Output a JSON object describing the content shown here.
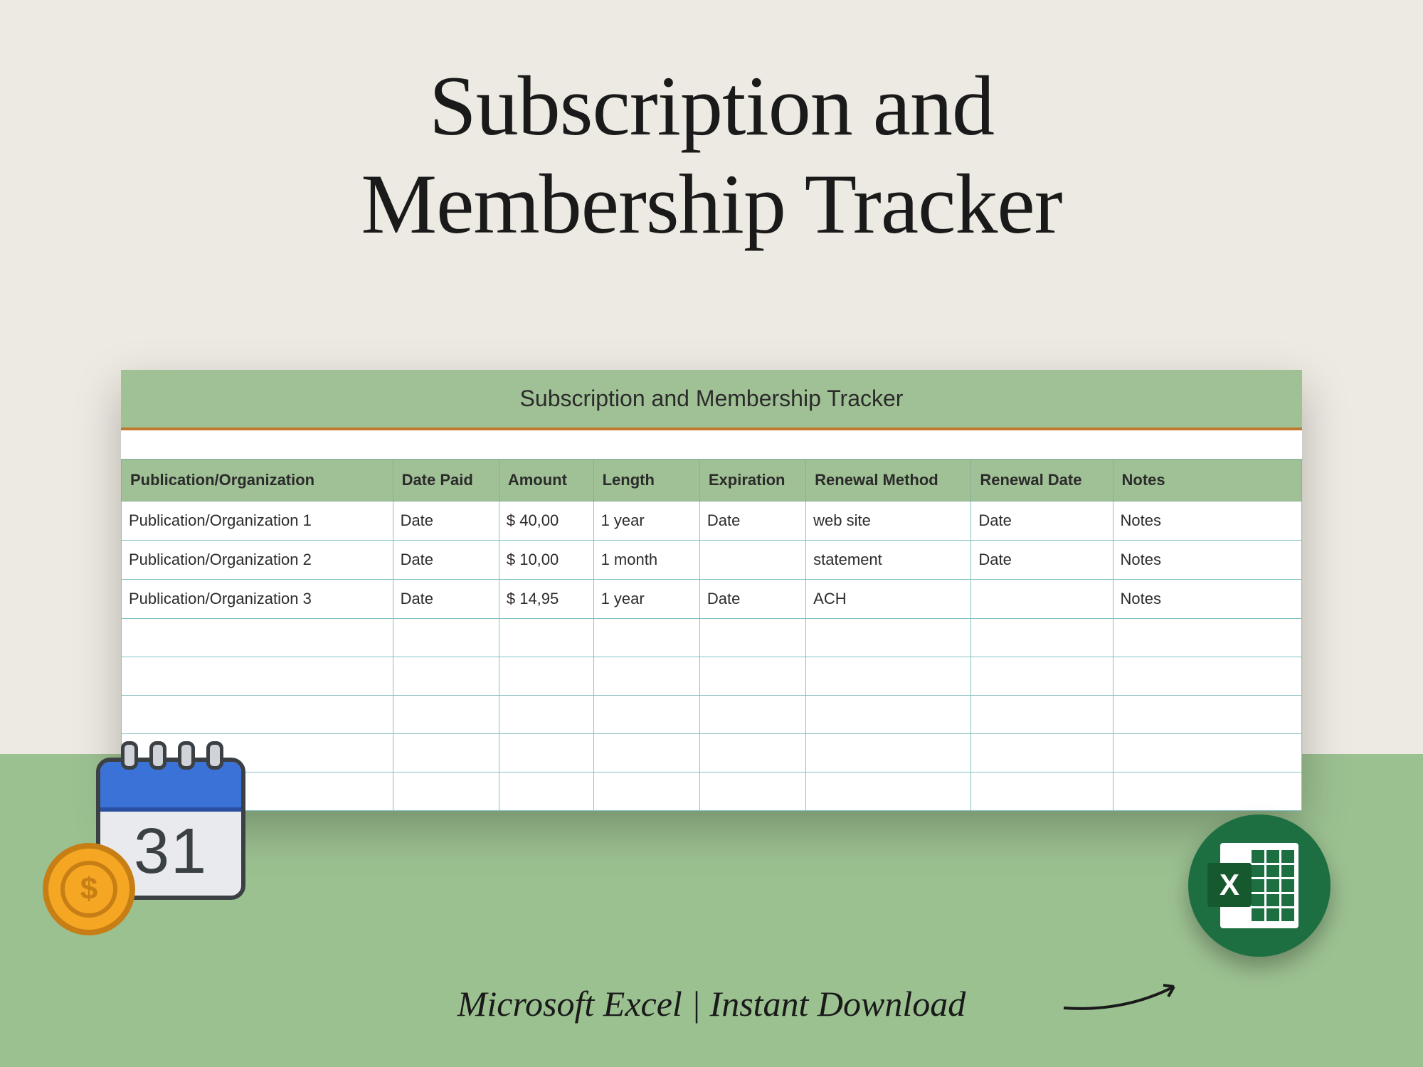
{
  "title_line1": "Subscription and",
  "title_line2": "Membership Tracker",
  "sheet_title": "Subscription and Membership Tracker",
  "columns": {
    "pub": "Publication/Organization",
    "date_paid": "Date Paid",
    "amount": "Amount",
    "length": "Length",
    "expiration": "Expiration",
    "renewal_method": "Renewal Method",
    "renewal_date": "Renewal Date",
    "notes": "Notes"
  },
  "rows": [
    {
      "pub": "Publication/Organization 1",
      "date_paid": "Date",
      "amount": "$   40,00",
      "length": "1 year",
      "expiration": "Date",
      "renewal_method": "web site",
      "renewal_date": "Date",
      "notes": "Notes"
    },
    {
      "pub": "Publication/Organization 2",
      "date_paid": "Date",
      "amount": "$    10,00",
      "length": "1 month",
      "expiration": "",
      "renewal_method": "statement",
      "renewal_date": "Date",
      "notes": "Notes"
    },
    {
      "pub": "Publication/Organization 3",
      "date_paid": "Date",
      "amount": "$    14,95",
      "length": "1 year",
      "expiration": "Date",
      "renewal_method": "ACH",
      "renewal_date": "",
      "notes": "Notes"
    },
    {
      "pub": "",
      "date_paid": "",
      "amount": "",
      "length": "",
      "expiration": "",
      "renewal_method": "",
      "renewal_date": "",
      "notes": ""
    },
    {
      "pub": "",
      "date_paid": "",
      "amount": "",
      "length": "",
      "expiration": "",
      "renewal_method": "",
      "renewal_date": "",
      "notes": ""
    },
    {
      "pub": "",
      "date_paid": "",
      "amount": "",
      "length": "",
      "expiration": "",
      "renewal_method": "",
      "renewal_date": "",
      "notes": ""
    },
    {
      "pub": "",
      "date_paid": "",
      "amount": "",
      "length": "",
      "expiration": "",
      "renewal_method": "",
      "renewal_date": "",
      "notes": ""
    },
    {
      "pub": "",
      "date_paid": "",
      "amount": "",
      "length": "",
      "expiration": "",
      "renewal_method": "",
      "renewal_date": "",
      "notes": ""
    }
  ],
  "calendar_day": "31",
  "coin_symbol": "$",
  "excel_letter": "X",
  "footer": "Microsoft Excel | Instant Download"
}
